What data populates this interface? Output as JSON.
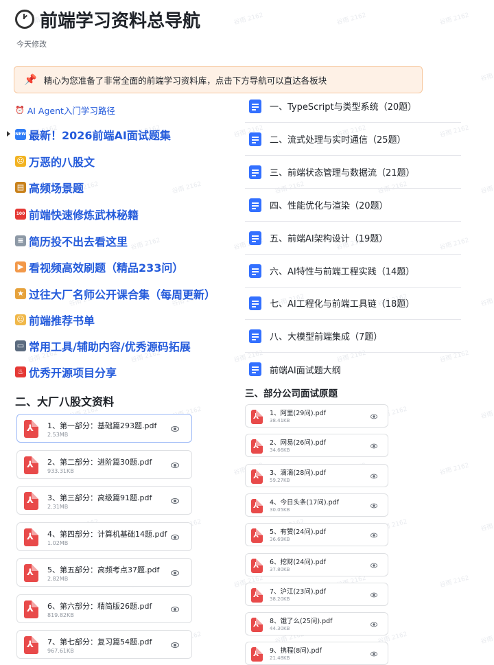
{
  "header": {
    "title": "前端学习资料总导航",
    "subtitle": "今天修改"
  },
  "callout": {
    "text": "精心为您准备了非常全面的前端学习资料库，点击下方导航可以直达各板块"
  },
  "left_nav": {
    "agent_link": "AI Agent入门学习路径",
    "items": [
      {
        "label": "最新！2026前端AI面试题集",
        "emoji_color": "#2f7cf6",
        "emoji_text": "NEW"
      },
      {
        "label": "万恶的八股文",
        "emoji_color": "#f2b322",
        "emoji_text": "☹"
      },
      {
        "label": "高频场景题",
        "emoji_color": "#c9821c",
        "emoji_text": "▤"
      },
      {
        "label": "前端快速修炼武林秘籍",
        "emoji_color": "#e53935",
        "emoji_text": "100"
      },
      {
        "label": "简历投不出去看这里",
        "emoji_color": "#8d99a6",
        "emoji_text": "≡"
      },
      {
        "label": "看视频高效刷题（精品233问）",
        "emoji_color": "#f2994a",
        "emoji_text": "▶"
      },
      {
        "label": "过往大厂名师公开课合集（每周更新）",
        "emoji_color": "#e6a23c",
        "emoji_text": "★"
      },
      {
        "label": "前端推荐书单",
        "emoji_color": "#f0b84a",
        "emoji_text": "☺"
      },
      {
        "label": "常用工具/辅助内容/优秀源码拓展",
        "emoji_color": "#5b6b7f",
        "emoji_text": "▭"
      },
      {
        "label": "优秀开源项目分享",
        "emoji_color": "#e53935",
        "emoji_text": "♨"
      }
    ]
  },
  "section_two": {
    "heading": "二、大厂八股文资料",
    "files": [
      {
        "name": "1、第一部分：基础篇293题.pdf",
        "size": "2.53MB"
      },
      {
        "name": "2、第二部分：进阶篇30题.pdf",
        "size": "933.31KB"
      },
      {
        "name": "3、第三部分：高级篇91题.pdf",
        "size": "2.31MB"
      },
      {
        "name": "4、第四部分：计算机基础14题.pdf",
        "size": "1.02MB"
      },
      {
        "name": "5、第五部分：高频考点37题.pdf",
        "size": "2.82MB"
      },
      {
        "name": "6、第六部分：精简版26题.pdf",
        "size": "819.82KB"
      },
      {
        "name": "7、第七部分：复习篇54题.pdf",
        "size": "967.61KB"
      }
    ]
  },
  "right_docs": {
    "items": [
      "一、TypeScript与类型系统（20题）",
      "二、流式处理与实时通信（25题）",
      "三、前端状态管理与数据流（21题）",
      "四、性能优化与渲染（20题）",
      "五、前端AI架构设计（19题）",
      "六、AI特性与前端工程实践（14题）",
      "七、AI工程化与前端工具链（18题）",
      "八、大模型前端集成（7题）",
      "前端AI面试题大纲"
    ]
  },
  "section_three": {
    "heading": "三、部分公司面试原题",
    "files": [
      {
        "name": "1、阿里(29问).pdf",
        "size": "38.41KB"
      },
      {
        "name": "2、网易(26问).pdf",
        "size": "34.66KB"
      },
      {
        "name": "3、滴滴(28问).pdf",
        "size": "59.27KB"
      },
      {
        "name": "4、今日头条(17问).pdf",
        "size": "30.05KB"
      },
      {
        "name": "5、有赞(24问).pdf",
        "size": "36.69KB"
      },
      {
        "name": "6、挖财(24问).pdf",
        "size": "37.80KB"
      },
      {
        "name": "7、沪江(23问).pdf",
        "size": "38.20KB"
      },
      {
        "name": "8、饿了么(25问).pdf",
        "size": "44.30KB"
      },
      {
        "name": "9、携程(8问).pdf",
        "size": "21.48KB"
      }
    ]
  },
  "watermark": "谷雨 2162"
}
